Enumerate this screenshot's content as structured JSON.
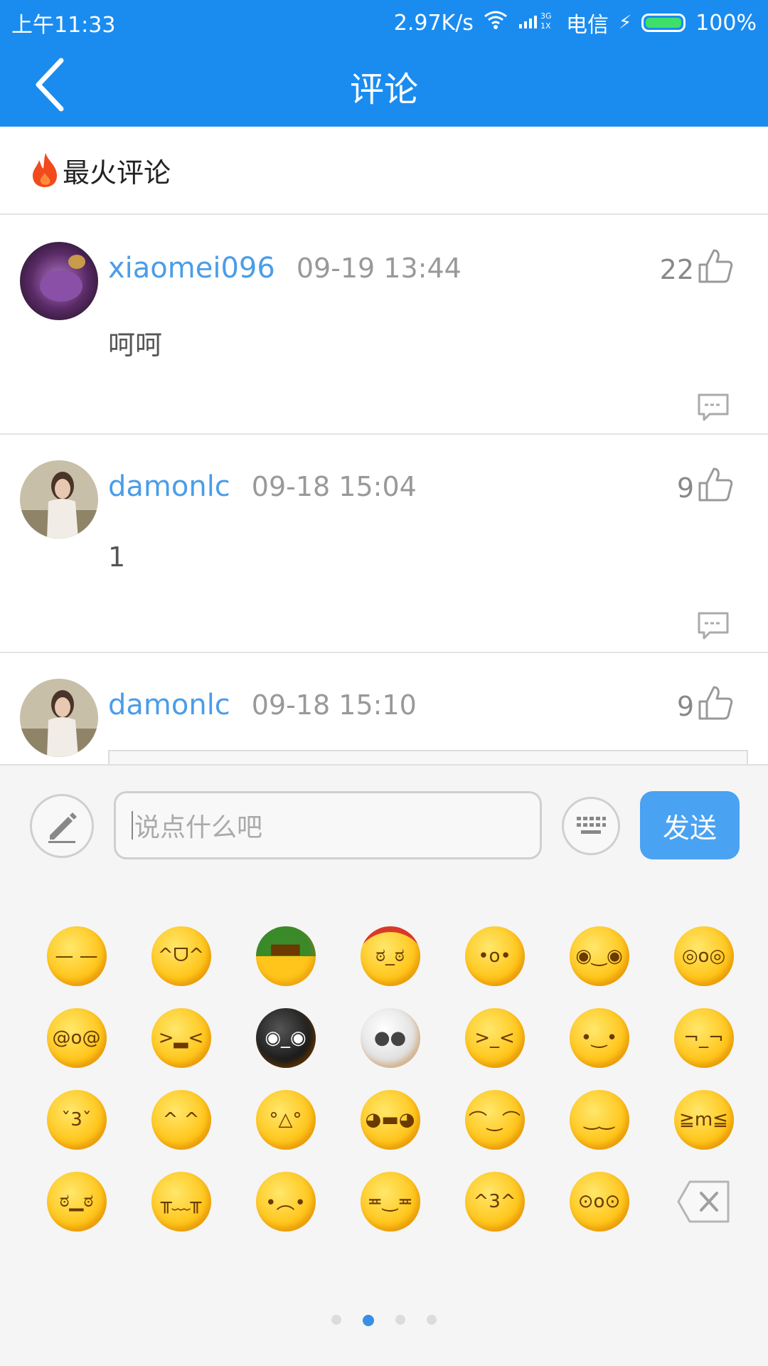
{
  "status_bar": {
    "time": "上午11:33",
    "speed": "2.97K/s",
    "carrier": "电信",
    "battery": "100%"
  },
  "header": {
    "title": "评论"
  },
  "section": {
    "title": "最火评论"
  },
  "comments": [
    {
      "user": "xiaomei096",
      "time": "09-19 13:44",
      "likes": "22",
      "text": "呵呵"
    },
    {
      "user": "damonlc",
      "time": "09-18 15:04",
      "likes": "9",
      "text": "1"
    },
    {
      "user": "damonlc",
      "time": "09-18 15:10",
      "likes": "9",
      "text": ""
    }
  ],
  "input": {
    "placeholder": "说点什么吧",
    "send_label": "发送"
  },
  "emoji_names": [
    "sweat-emoji",
    "laugh-emoji",
    "soldier-emoji",
    "angry-headband-emoji",
    "surprised-emoji",
    "confused-emoji",
    "shocked-emoji",
    "dizzy-emoji",
    "crying-emoji",
    "dark-sweat-emoji",
    "skull-emoji",
    "hammer-emoji",
    "thinking-emoji",
    "smug-emoji",
    "shy-emoji",
    "hands-cover-emoji",
    "nervous-emoji",
    "grin-emoji",
    "content-emoji",
    "pleased-emoji",
    "snicker-emoji",
    "grumpy-emoji",
    "pout-emoji",
    "sad-emoji",
    "sly-emoji",
    "kiss-emoji",
    "startled-emoji"
  ],
  "emoji_page": {
    "total": 4,
    "current": 2
  },
  "colors": {
    "primary": "#1a8cf0",
    "username": "#4a9de8",
    "send": "#4aa2f2"
  }
}
